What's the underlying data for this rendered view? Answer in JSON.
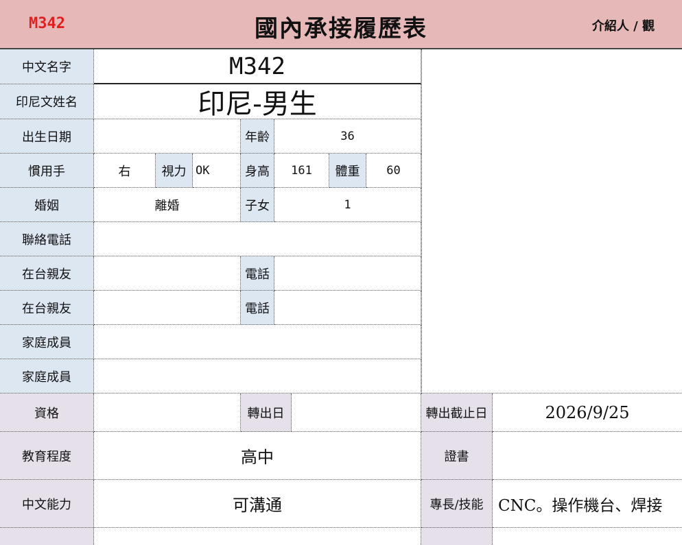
{
  "header": {
    "code": "M342",
    "title": "國內承接履歷表",
    "referrer": "介紹人 / 觀"
  },
  "labels": {
    "chinese_name": "中文名字",
    "indonesian_name": "印尼文姓名",
    "birth_date": "出生日期",
    "age": "年齡",
    "handedness": "慣用手",
    "vision": "視力",
    "height": "身高",
    "weight": "體重",
    "marriage": "婚姻",
    "children": "子女",
    "contact_phone": "聯絡電話",
    "relatives_1": "在台親友",
    "phone_1": "電話",
    "relatives_2": "在台親友",
    "phone_2": "電話",
    "family_1": "家庭成員",
    "family_2": "家庭成員",
    "qualification": "資格",
    "transfer_date": "轉出日",
    "transfer_deadline": "轉出截止日",
    "education": "教育程度",
    "certificate": "證書",
    "chinese_ability": "中文能力",
    "skills": "專長/技能"
  },
  "values": {
    "chinese_name": "M342",
    "indonesian_name": "印尼-男生",
    "birth_date": "",
    "age": "36",
    "handedness": "右",
    "vision": "OK",
    "height": "161",
    "weight": "60",
    "marriage": "離婚",
    "children": "1",
    "contact_phone": "",
    "relatives_1": "",
    "phone_1": "",
    "relatives_2": "",
    "phone_2": "",
    "family_1": "",
    "family_2": "",
    "qualification": "",
    "transfer_date": "",
    "transfer_deadline": "2026/9/25",
    "education": "高中",
    "certificate": "",
    "chinese_ability": "可溝通",
    "skills": "CNC。操作機台、焊接"
  },
  "colors": {
    "header_bg": "#e6b8b8",
    "code_red": "#e02020",
    "label_blue": "#dde7f2",
    "label_lilac": "#e5e0ea"
  }
}
